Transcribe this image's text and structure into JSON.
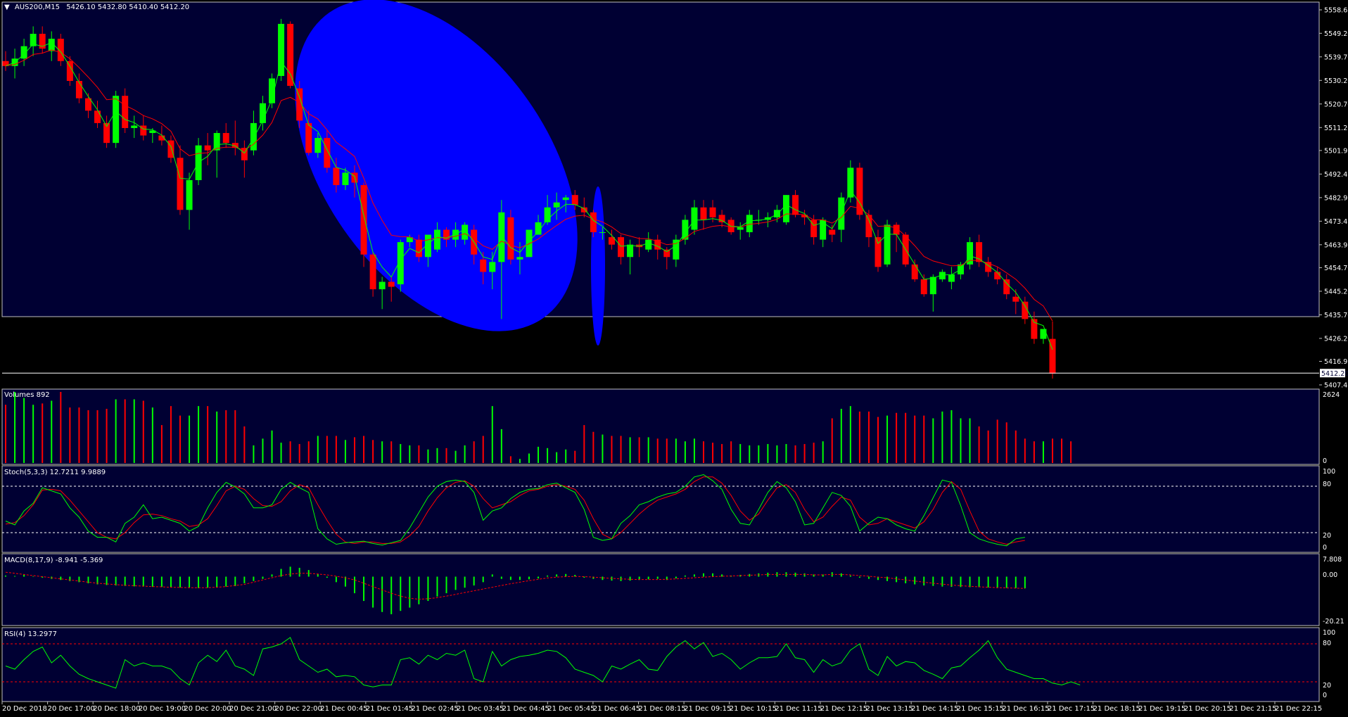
{
  "colors": {
    "background": "#000033",
    "outer": "#000000",
    "foreground": "#ffffff",
    "grid": "#c0c0c0",
    "bull": "#00ff00",
    "bear": "#ff0000",
    "ma_fast": "#00ff00",
    "ma_slow": "#ff0000",
    "highlight": "#0000ff",
    "level_line": "#ffffff",
    "rsi_level": "#ff0000"
  },
  "main_pane": {
    "title_marker": "▼",
    "title": "AUS200,M15",
    "ohlc": "5426.10 5432.80 5410.40 5412.20",
    "price_ticks": [
      "5558.65",
      "5549.20",
      "5539.70",
      "5530.20",
      "5520.70",
      "5511.20",
      "5501.95",
      "5492.45",
      "5482.95",
      "5473.45",
      "5463.95",
      "5454.70",
      "5445.20",
      "5435.70",
      "5426.20",
      "5416.95",
      "5407.45"
    ],
    "current_price_label": "5412.20"
  },
  "volume_pane": {
    "title": "Volumes 892",
    "ticks": [
      "2624",
      "0"
    ]
  },
  "stoch_pane": {
    "title": "Stoch(5,3,3) 12.7211 9.9889",
    "ticks": [
      "100",
      "80",
      "20",
      "0"
    ]
  },
  "macd_pane": {
    "title": "MACD(8,17,9) -8.941 -5.369",
    "ticks": [
      "7.808",
      "0.00",
      "-20.21"
    ]
  },
  "rsi_pane": {
    "title": "RSI(4) 13.2977",
    "ticks": [
      "100",
      "80",
      "20",
      "0"
    ]
  },
  "time_labels": [
    "20 Dec 2018",
    "20 Dec 17:00",
    "20 Dec 18:00",
    "20 Dec 19:00",
    "20 Dec 20:00",
    "20 Dec 21:00",
    "20 Dec 22:00",
    "21 Dec 00:45",
    "21 Dec 01:45",
    "21 Dec 02:45",
    "21 Dec 03:45",
    "21 Dec 04:45",
    "21 Dec 05:45",
    "21 Dec 06:45",
    "21 Dec 08:15",
    "21 Dec 09:15",
    "21 Dec 10:15",
    "21 Dec 11:15",
    "21 Dec 12:15",
    "21 Dec 13:15",
    "21 Dec 14:15",
    "21 Dec 15:15",
    "21 Dec 16:15",
    "21 Dec 17:15",
    "21 Dec 18:15",
    "21 Dec 19:15",
    "21 Dec 20:15",
    "21 Dec 21:15",
    "21 Dec 22:15"
  ],
  "chart_data": {
    "type": "candlestick",
    "symbol": "AUS200",
    "timeframe": "M15",
    "price_range": [
      5407.45,
      5558.65
    ],
    "candles": [
      [
        5538,
        5542,
        5534,
        5536
      ],
      [
        5536,
        5543,
        5531,
        5539
      ],
      [
        5539,
        5547,
        5536,
        5544
      ],
      [
        5544,
        5552,
        5540,
        5549
      ],
      [
        5549,
        5552,
        5541,
        5543
      ],
      [
        5542,
        5550,
        5538,
        5547
      ],
      [
        5547,
        5549,
        5536,
        5538
      ],
      [
        5538,
        5540,
        5528,
        5530
      ],
      [
        5530,
        5533,
        5521,
        5523
      ],
      [
        5523,
        5525,
        5515,
        5518
      ],
      [
        5518,
        5522,
        5511,
        5513
      ],
      [
        5513,
        5516,
        5503,
        5505
      ],
      [
        5505,
        5526,
        5503,
        5524
      ],
      [
        5524,
        5527,
        5509,
        5511
      ],
      [
        5511,
        5516,
        5507,
        5512
      ],
      [
        5512,
        5516,
        5506,
        5508
      ],
      [
        5509,
        5511,
        5505,
        5510
      ],
      [
        5508,
        5512,
        5504,
        5506
      ],
      [
        5506,
        5508,
        5497,
        5499
      ],
      [
        5499,
        5504,
        5476,
        5478
      ],
      [
        5478,
        5493,
        5470,
        5490
      ],
      [
        5490,
        5507,
        5488,
        5504
      ],
      [
        5504,
        5509,
        5496,
        5502
      ],
      [
        5502,
        5510,
        5491,
        5509
      ],
      [
        5509,
        5513,
        5503,
        5505
      ],
      [
        5505,
        5514,
        5500,
        5503
      ],
      [
        5503,
        5506,
        5491,
        5498
      ],
      [
        5502,
        5518,
        5500,
        5513
      ],
      [
        5513,
        5524,
        5510,
        5521
      ],
      [
        5521,
        5533,
        5519,
        5531
      ],
      [
        5532,
        5555,
        5530,
        5553
      ],
      [
        5553,
        5554,
        5527,
        5528
      ],
      [
        5527,
        5530,
        5511,
        5514
      ],
      [
        5513,
        5518,
        5500,
        5501
      ],
      [
        5501,
        5509,
        5499,
        5507
      ],
      [
        5507,
        5510,
        5493,
        5495
      ],
      [
        5495,
        5499,
        5485,
        5488
      ],
      [
        5488,
        5495,
        5486,
        5493
      ],
      [
        5493,
        5496,
        5483,
        5489
      ],
      [
        5488,
        5489,
        5455,
        5460
      ],
      [
        5460,
        5461,
        5443,
        5446
      ],
      [
        5446,
        5451,
        5438,
        5449
      ],
      [
        5449,
        5451,
        5441,
        5447
      ],
      [
        5448,
        5466,
        5445,
        5465
      ],
      [
        5465,
        5468,
        5463,
        5467
      ],
      [
        5466,
        5468,
        5457,
        5459
      ],
      [
        5459,
        5467,
        5455,
        5468
      ],
      [
        5462,
        5473,
        5461,
        5470
      ],
      [
        5470,
        5471,
        5463,
        5466
      ],
      [
        5466,
        5473,
        5463,
        5470
      ],
      [
        5466,
        5473,
        5464,
        5472
      ],
      [
        5470,
        5472,
        5456,
        5460
      ],
      [
        5458,
        5461,
        5448,
        5453
      ],
      [
        5453,
        5461,
        5446,
        5457
      ],
      [
        5457,
        5482,
        5434,
        5477
      ],
      [
        5475,
        5478,
        5456,
        5458
      ],
      [
        5458,
        5465,
        5452,
        5459
      ],
      [
        5459,
        5469,
        5459,
        5470
      ],
      [
        5468,
        5476,
        5468,
        5473
      ],
      [
        5473,
        5484,
        5472,
        5479
      ],
      [
        5479,
        5485,
        5474,
        5481
      ],
      [
        5482,
        5484,
        5477,
        5483
      ],
      [
        5484,
        5486,
        5478,
        5480
      ],
      [
        5479,
        5483,
        5475,
        5477
      ],
      [
        5477,
        5478,
        5467,
        5469
      ],
      [
        5469,
        5471,
        5466,
        5469
      ],
      [
        5467,
        5470,
        5462,
        5464
      ],
      [
        5467,
        5468,
        5456,
        5459
      ],
      [
        5459,
        5466,
        5452,
        5464
      ],
      [
        5464,
        5467,
        5459,
        5463
      ],
      [
        5462,
        5469,
        5461,
        5466
      ],
      [
        5466,
        5468,
        5458,
        5462
      ],
      [
        5462,
        5463,
        5454,
        5459
      ],
      [
        5458,
        5468,
        5455,
        5466
      ],
      [
        5466,
        5476,
        5464,
        5474
      ],
      [
        5470,
        5482,
        5468,
        5479
      ],
      [
        5479,
        5482,
        5470,
        5474
      ],
      [
        5479,
        5482,
        5473,
        5475
      ],
      [
        5476,
        5478,
        5471,
        5473
      ],
      [
        5474,
        5475,
        5468,
        5469
      ],
      [
        5470,
        5473,
        5466,
        5471
      ],
      [
        5469,
        5478,
        5467,
        5476
      ],
      [
        5474,
        5478,
        5472,
        5474
      ],
      [
        5474,
        5477,
        5471,
        5475
      ],
      [
        5475,
        5480,
        5473,
        5478
      ],
      [
        5473,
        5484,
        5472,
        5484
      ],
      [
        5484,
        5486,
        5475,
        5476
      ],
      [
        5476,
        5478,
        5472,
        5475
      ],
      [
        5474,
        5476,
        5464,
        5467
      ],
      [
        5466,
        5475,
        5463,
        5474
      ],
      [
        5470,
        5472,
        5465,
        5468
      ],
      [
        5470,
        5485,
        5465,
        5483
      ],
      [
        5483,
        5498,
        5481,
        5495
      ],
      [
        5495,
        5497,
        5474,
        5476
      ],
      [
        5476,
        5478,
        5463,
        5467
      ],
      [
        5467,
        5470,
        5453,
        5455
      ],
      [
        5456,
        5474,
        5455,
        5472
      ],
      [
        5472,
        5473,
        5461,
        5468
      ],
      [
        5468,
        5469,
        5455,
        5456
      ],
      [
        5456,
        5458,
        5449,
        5450
      ],
      [
        5450,
        5452,
        5443,
        5444
      ],
      [
        5444,
        5452,
        5437,
        5451
      ],
      [
        5450,
        5454,
        5449,
        5453
      ],
      [
        5449,
        5455,
        5446,
        5452
      ],
      [
        5452,
        5457,
        5450,
        5456
      ],
      [
        5456,
        5467,
        5454,
        5465
      ],
      [
        5465,
        5468,
        5455,
        5457
      ],
      [
        5457,
        5459,
        5451,
        5453
      ],
      [
        5453,
        5455,
        5448,
        5450
      ],
      [
        5450,
        5452,
        5442,
        5444
      ],
      [
        5443,
        5446,
        5436,
        5441
      ],
      [
        5441,
        5443,
        5432,
        5434
      ],
      [
        5434,
        5437,
        5424,
        5426
      ],
      [
        5426,
        5430,
        5424,
        5430
      ],
      [
        5426,
        5433,
        5410,
        5412
      ]
    ],
    "volume": {
      "range": [
        0,
        2624
      ],
      "values": [
        2150,
        2624,
        2400,
        2150,
        2200,
        2300,
        2624,
        2050,
        2050,
        1950,
        1950,
        2000,
        2350,
        2350,
        2350,
        2300,
        2050,
        1400,
        2100,
        1750,
        1750,
        2100,
        2100,
        1900,
        1950,
        1950,
        1350,
        650,
        900,
        1200,
        750,
        800,
        700,
        800,
        1000,
        1000,
        1000,
        850,
        950,
        1000,
        850,
        800,
        800,
        700,
        650,
        650,
        500,
        550,
        550,
        450,
        650,
        800,
        1000,
        2100,
        1250,
        250,
        150,
        350,
        600,
        550,
        400,
        500,
        450,
        1400,
        1150,
        1050,
        1000,
        1000,
        950,
        950,
        950,
        900,
        900,
        900,
        800,
        900,
        800,
        750,
        700,
        800,
        700,
        650,
        650,
        700,
        650,
        700,
        650,
        700,
        750,
        800,
        1650,
        2000,
        2100,
        1900,
        1900,
        1700,
        1750,
        1850,
        1850,
        1750,
        1750,
        1650,
        1900,
        1950,
        1650,
        1650,
        1350,
        1200,
        1600,
        1500,
        1200,
        900,
        800,
        800,
        900,
        900,
        800
      ]
    },
    "stochastic": {
      "range": [
        0,
        100
      ],
      "levels": [
        80,
        20
      ],
      "k": [
        35,
        30,
        48,
        58,
        78,
        74,
        70,
        52,
        40,
        22,
        14,
        14,
        8,
        32,
        40,
        56,
        38,
        40,
        36,
        32,
        22,
        28,
        52,
        72,
        85,
        79,
        70,
        52,
        52,
        56,
        76,
        85,
        78,
        72,
        25,
        12,
        5,
        7,
        8,
        9,
        6,
        4,
        7,
        10,
        26,
        46,
        66,
        80,
        86,
        88,
        86,
        72,
        36,
        48,
        52,
        64,
        72,
        76,
        77,
        82,
        84,
        78,
        72,
        50,
        14,
        10,
        12,
        32,
        42,
        56,
        60,
        66,
        70,
        72,
        80,
        92,
        95,
        87,
        76,
        50,
        32,
        30,
        50,
        72,
        86,
        78,
        60,
        30,
        32,
        52,
        72,
        68,
        54,
        22,
        32,
        40,
        38,
        30,
        25,
        22,
        42,
        65,
        88,
        85,
        55,
        20,
        12,
        8,
        5,
        3,
        12,
        14
      ],
      "d": [
        31,
        33,
        42,
        56,
        75,
        76,
        74,
        62,
        48,
        34,
        20,
        14,
        12,
        20,
        33,
        43,
        44,
        42,
        38,
        35,
        28,
        30,
        38,
        55,
        74,
        80,
        76,
        64,
        55,
        54,
        60,
        74,
        82,
        78,
        56,
        36,
        18,
        8,
        6,
        8,
        8,
        6,
        6,
        8,
        16,
        28,
        48,
        65,
        78,
        85,
        87,
        80,
        64,
        52,
        56,
        60,
        68,
        74,
        76,
        80,
        82,
        80,
        76,
        62,
        38,
        18,
        12,
        20,
        32,
        44,
        54,
        62,
        66,
        70,
        76,
        86,
        92,
        92,
        84,
        68,
        48,
        36,
        44,
        62,
        78,
        82,
        72,
        50,
        34,
        40,
        54,
        66,
        62,
        40,
        30,
        32,
        38,
        34,
        30,
        26,
        34,
        50,
        72,
        86,
        76,
        48,
        22,
        12,
        8,
        5,
        8,
        10
      ]
    },
    "macd": {
      "range": [
        -20.21,
        7.808
      ],
      "histogram": [
        0.5,
        0.3,
        0.8,
        0.2,
        -0.5,
        -1.0,
        -1.5,
        -2.0,
        -2.5,
        -3.0,
        -3.5,
        -3.8,
        -4.0,
        -4.2,
        -4.4,
        -4.5,
        -4.6,
        -4.7,
        -4.8,
        -4.9,
        -5.0,
        -5.2,
        -5.0,
        -4.8,
        -4.5,
        -4.3,
        -3.0,
        -2.0,
        -1.0,
        1.0,
        3.5,
        4.5,
        4.0,
        3.0,
        1.2,
        -0.5,
        -2.5,
        -4.5,
        -7.5,
        -11,
        -14,
        -16,
        -17,
        -15.5,
        -14,
        -12.5,
        -11,
        -9,
        -7.5,
        -6,
        -5,
        -4,
        -2.5,
        1.0,
        -1.0,
        -1.5,
        -1.5,
        -1.2,
        -0.8,
        0.5,
        1.0,
        1.2,
        0.8,
        -0.5,
        -1.0,
        -1.5,
        -1.8,
        -2.0,
        -1.8,
        -1.5,
        -1.2,
        -1.0,
        -1.5,
        -0.8,
        0.5,
        1.0,
        1.5,
        1.5,
        1.0,
        0.5,
        0.8,
        1.2,
        1.5,
        1.8,
        2.0,
        2.0,
        1.8,
        1.5,
        1.0,
        1.0,
        2.0,
        1.5,
        0.5,
        -0.5,
        -1.0,
        -1.5,
        -2.0,
        -2.5,
        -3.0,
        -3.5,
        -4.0,
        -4.2,
        -4.5,
        -4.6,
        -4.7,
        -4.8,
        -4.8,
        -4.9,
        -5.0,
        -5.1,
        -5.2,
        -5.3
      ],
      "signal": [
        2.0,
        1.5,
        1.0,
        0.5,
        0,
        -0.5,
        -1.0,
        -1.5,
        -2.0,
        -2.5,
        -3.0,
        -3.3,
        -3.6,
        -3.9,
        -4.1,
        -4.3,
        -4.5,
        -4.6,
        -4.8,
        -4.9,
        -5.0,
        -5.0,
        -5.0,
        -4.8,
        -4.5,
        -4.0,
        -3.5,
        -2.5,
        -1.5,
        -0.5,
        0.5,
        1.2,
        1.5,
        1.5,
        1.2,
        0.8,
        0.2,
        -0.5,
        -1.5,
        -3.0,
        -4.5,
        -6.0,
        -7.5,
        -8.8,
        -9.8,
        -10.2,
        -10.0,
        -9.5,
        -8.8,
        -8.0,
        -7.2,
        -6.4,
        -5.6,
        -4.8,
        -4.0,
        -3.2,
        -2.5,
        -1.8,
        -1.2,
        -0.6,
        -0.2,
        0,
        0.1,
        0,
        -0.2,
        -0.5,
        -0.8,
        -1.0,
        -1.2,
        -1.3,
        -1.3,
        -1.3,
        -1.2,
        -1.0,
        -0.8,
        -0.5,
        -0.2,
        0,
        0.2,
        0.3,
        0.5,
        0.6,
        0.8,
        1.0,
        1.0,
        1.0,
        1.0,
        1.0,
        0.8,
        0.8,
        1.0,
        1.0,
        0.8,
        0.5,
        0.2,
        -0.2,
        -0.5,
        -1.0,
        -1.5,
        -2.0,
        -2.5,
        -3.0,
        -3.4,
        -3.8,
        -4.1,
        -4.4,
        -4.6,
        -4.8,
        -5.0,
        -5.1,
        -5.2,
        -5.3
      ]
    },
    "rsi": {
      "range": [
        0,
        100
      ],
      "levels": [
        80,
        20
      ],
      "values": [
        45,
        40,
        55,
        68,
        75,
        50,
        62,
        45,
        32,
        25,
        20,
        15,
        10,
        55,
        45,
        50,
        45,
        45,
        40,
        25,
        15,
        50,
        62,
        52,
        70,
        45,
        40,
        30,
        72,
        75,
        80,
        90,
        55,
        45,
        35,
        40,
        28,
        30,
        28,
        15,
        12,
        15,
        15,
        55,
        58,
        48,
        62,
        55,
        65,
        62,
        70,
        25,
        20,
        68,
        45,
        55,
        60,
        62,
        65,
        70,
        68,
        58,
        40,
        35,
        30,
        20,
        45,
        40,
        48,
        55,
        40,
        38,
        60,
        75,
        85,
        72,
        82,
        60,
        65,
        55,
        40,
        50,
        58,
        58,
        60,
        80,
        58,
        55,
        35,
        55,
        45,
        50,
        70,
        80,
        40,
        30,
        60,
        45,
        52,
        50,
        38,
        32,
        25,
        42,
        45,
        58,
        70,
        85,
        58,
        40,
        35,
        30,
        25,
        25,
        18,
        15,
        20,
        15
      ]
    }
  }
}
